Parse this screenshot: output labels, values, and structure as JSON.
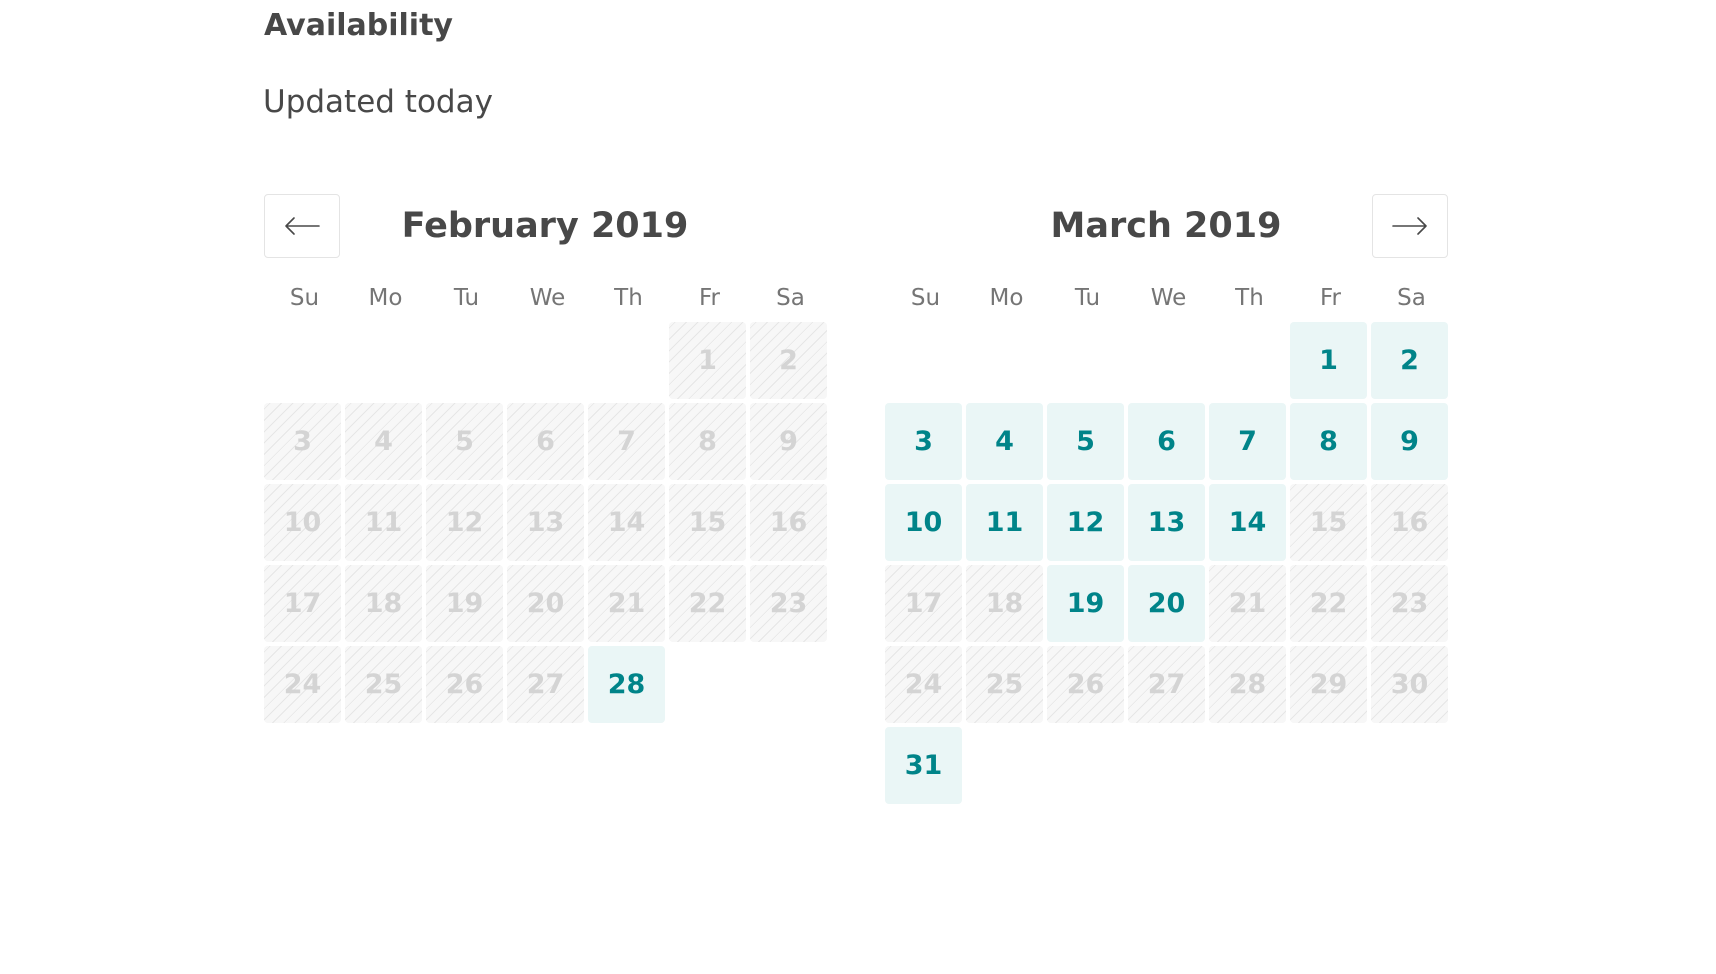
{
  "availability": {
    "title": "Availability",
    "updated": "Updated today"
  },
  "nav": {
    "prev_icon": "arrow-left-icon",
    "next_icon": "arrow-right-icon"
  },
  "colors": {
    "available_text": "#008489",
    "available_bg": "#eaf6f6",
    "unavailable_text": "#d4d4d4",
    "heading": "#484848"
  },
  "weekdays": [
    "Su",
    "Mo",
    "Tu",
    "We",
    "Th",
    "Fr",
    "Sa"
  ],
  "months": [
    {
      "id": "feb",
      "title": "February 2019",
      "leading_blanks": 5,
      "days": [
        {
          "d": "1",
          "s": "u"
        },
        {
          "d": "2",
          "s": "u"
        },
        {
          "d": "3",
          "s": "u"
        },
        {
          "d": "4",
          "s": "u"
        },
        {
          "d": "5",
          "s": "u"
        },
        {
          "d": "6",
          "s": "u"
        },
        {
          "d": "7",
          "s": "u"
        },
        {
          "d": "8",
          "s": "u"
        },
        {
          "d": "9",
          "s": "u"
        },
        {
          "d": "10",
          "s": "u"
        },
        {
          "d": "11",
          "s": "u"
        },
        {
          "d": "12",
          "s": "u"
        },
        {
          "d": "13",
          "s": "u"
        },
        {
          "d": "14",
          "s": "u"
        },
        {
          "d": "15",
          "s": "u"
        },
        {
          "d": "16",
          "s": "u"
        },
        {
          "d": "17",
          "s": "u"
        },
        {
          "d": "18",
          "s": "u"
        },
        {
          "d": "19",
          "s": "u"
        },
        {
          "d": "20",
          "s": "u"
        },
        {
          "d": "21",
          "s": "u"
        },
        {
          "d": "22",
          "s": "u"
        },
        {
          "d": "23",
          "s": "u"
        },
        {
          "d": "24",
          "s": "u"
        },
        {
          "d": "25",
          "s": "u"
        },
        {
          "d": "26",
          "s": "u"
        },
        {
          "d": "27",
          "s": "u"
        },
        {
          "d": "28",
          "s": "a"
        }
      ]
    },
    {
      "id": "mar",
      "title": "March 2019",
      "leading_blanks": 5,
      "days": [
        {
          "d": "1",
          "s": "a"
        },
        {
          "d": "2",
          "s": "a"
        },
        {
          "d": "3",
          "s": "a"
        },
        {
          "d": "4",
          "s": "a"
        },
        {
          "d": "5",
          "s": "a"
        },
        {
          "d": "6",
          "s": "a"
        },
        {
          "d": "7",
          "s": "a"
        },
        {
          "d": "8",
          "s": "a"
        },
        {
          "d": "9",
          "s": "a"
        },
        {
          "d": "10",
          "s": "a"
        },
        {
          "d": "11",
          "s": "a"
        },
        {
          "d": "12",
          "s": "a"
        },
        {
          "d": "13",
          "s": "a"
        },
        {
          "d": "14",
          "s": "a"
        },
        {
          "d": "15",
          "s": "u"
        },
        {
          "d": "16",
          "s": "u"
        },
        {
          "d": "17",
          "s": "u"
        },
        {
          "d": "18",
          "s": "u"
        },
        {
          "d": "19",
          "s": "a"
        },
        {
          "d": "20",
          "s": "a"
        },
        {
          "d": "21",
          "s": "u"
        },
        {
          "d": "22",
          "s": "u"
        },
        {
          "d": "23",
          "s": "u"
        },
        {
          "d": "24",
          "s": "u"
        },
        {
          "d": "25",
          "s": "u"
        },
        {
          "d": "26",
          "s": "u"
        },
        {
          "d": "27",
          "s": "u"
        },
        {
          "d": "28",
          "s": "u"
        },
        {
          "d": "29",
          "s": "u"
        },
        {
          "d": "30",
          "s": "u"
        },
        {
          "d": "31",
          "s": "a"
        }
      ]
    }
  ]
}
